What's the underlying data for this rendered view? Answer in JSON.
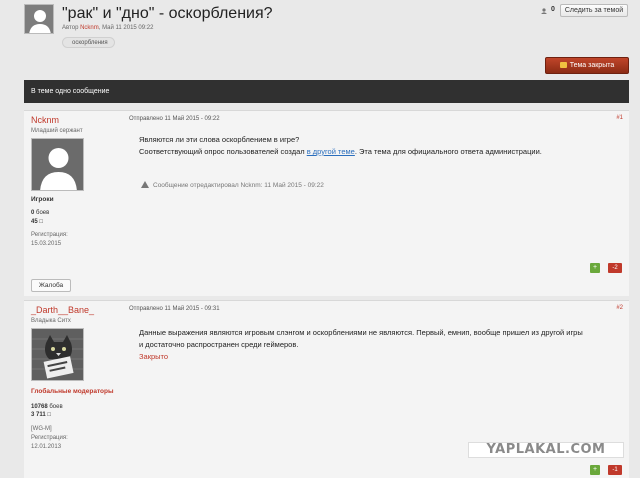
{
  "header": {
    "title": "\"рак\" и \"дно\" - оскорбления?",
    "author_prefix": "Автор",
    "author": "Ncknm",
    "date": ", Май 11 2015 09:22",
    "tag": "оскорбления",
    "follow_count": "0",
    "follow_label": "Следить за темой",
    "closed_label": "Тема закрыта"
  },
  "topic_bar": {
    "text": "В теме одно сообщение"
  },
  "posts": [
    {
      "author": "Ncknm",
      "rank": "Младший сержант",
      "group": "Игроки",
      "stat1": "0",
      "stat1_label": " боев",
      "stat2": "45",
      "stat2_icon": "□",
      "reg_label": "Регистрация:",
      "reg_date": "15.03.2015",
      "date": "Отправлено 11 Май 2015 - 09:22",
      "number": "#1",
      "line1": "Являются ли эти слова оскорблением в игре?",
      "line2_pre": "Соответствующий опрос пользователей создал ",
      "line2_link": "в другой теме",
      "line2_post": ". Эта тема для официального ответа администрации.",
      "edited": "Сообщение отредактировал Ncknm: 11 Май 2015 - 09:22",
      "report_label": "Жалоба",
      "vote_up": "+",
      "score": "-2"
    },
    {
      "author": "_Darth__Bane_",
      "rank": "Владыка Ситх",
      "group": "Глобальные модераторы",
      "stat1": "10768",
      "stat1_label": " боев",
      "stat2": "3 711",
      "stat2_icon": "□",
      "clan": "[WG-M]",
      "reg_label": "Регистрация:",
      "reg_date": "12.01.2013",
      "date": "Отправлено 11 Май 2015 - 09:31",
      "number": "#2",
      "line1": "Данные выражения являются игровым слэнгом и оскорблениями не являются. Первый, емнип, вообще пришел из другой игры",
      "line2": "и достаточно распространен среди геймеров.",
      "line3": "Закрыто",
      "vote_up": "+",
      "score": "-1"
    }
  ],
  "watermark": "YAPLAKAL.COM"
}
